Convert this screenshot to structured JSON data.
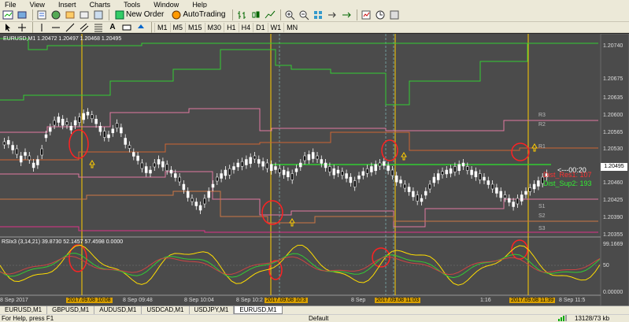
{
  "menu": [
    "File",
    "View",
    "Insert",
    "Charts",
    "Tools",
    "Window",
    "Help"
  ],
  "toolbar": {
    "new_order": "New Order",
    "autotrading": "AutoTrading"
  },
  "timeframes": [
    "M1",
    "M5",
    "M15",
    "M30",
    "H1",
    "H4",
    "D1",
    "W1",
    "MN"
  ],
  "active_timeframe": "M1",
  "chart": {
    "title": "EURUSD,M1  1.20472 1.20497 1.20468 1.20495",
    "price_ticks": [
      "1.20740",
      "1.20675",
      "1.20635",
      "1.20600",
      "1.20565",
      "1.20530",
      "1.20495",
      "1.20460",
      "1.20425",
      "1.20390",
      "1.20355"
    ],
    "current_price": "1.20495",
    "countdown": "<---00:20",
    "annotation_red": "Dist_Res1: 107",
    "annotation_green": "Dist_Sup2: 193",
    "level_labels": [
      "R3",
      "R2",
      "R1",
      "S1",
      "S2",
      "S3"
    ]
  },
  "indicator": {
    "title": "RSIx3 (3,14,21) 39.8730 52.1457 57.4598 0.0000",
    "ticks": [
      "99.1669",
      "50",
      "0.00000"
    ]
  },
  "time_axis": [
    "8 Sep 2017",
    "2017.09.08 10:08",
    "8 Sep 09:48",
    "8 Sep 10:04",
    "8 Sep 10:2",
    "2017.09.08 10:3",
    "8 Sep",
    "2017.09.08 11:03",
    "1:16",
    "2017.09.08 11:39",
    "8 Sep 11:5"
  ],
  "tabs": [
    "EURUSD,M1",
    "GBPUSD,M1",
    "AUDUSD,M1",
    "USDCAD,M1",
    "USDJPY,M1",
    "EURUSD,M1"
  ],
  "active_tab": 5,
  "status": {
    "help": "For Help, press F1",
    "profile": "Default",
    "connection": "13128/73 kb"
  },
  "colors": {
    "chart_bg": "#4b4b4b",
    "green": "#33cc33",
    "pink": "#e07aa0",
    "orange": "#cc6633",
    "yellow": "#ffcc00",
    "red_circle": "#ff2222"
  }
}
